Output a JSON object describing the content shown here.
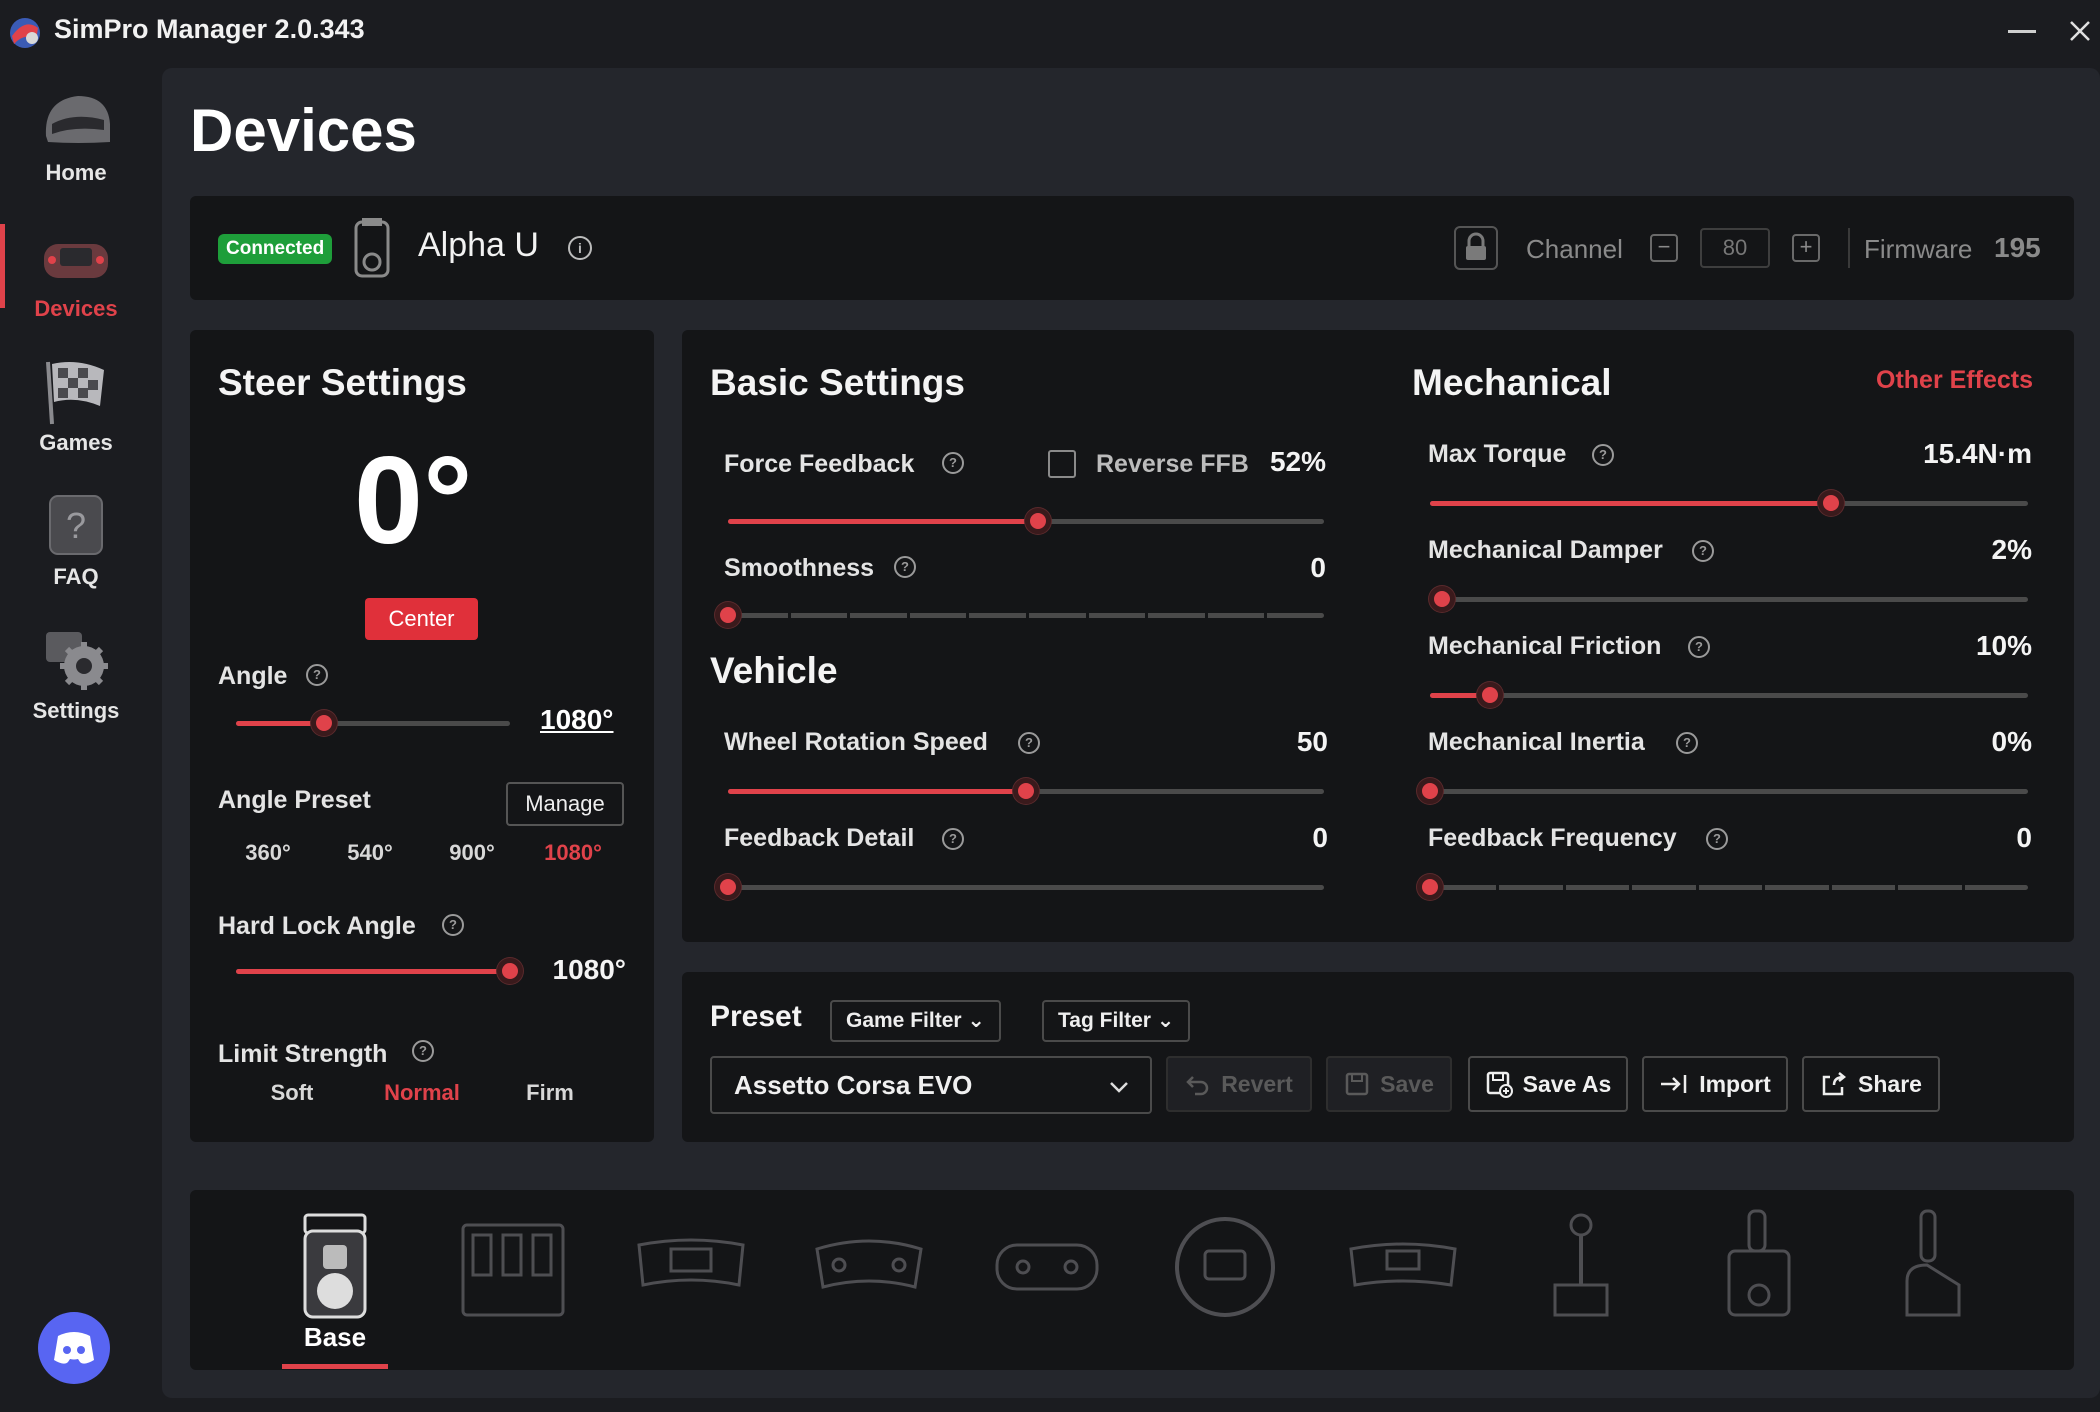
{
  "window": {
    "title": "SimPro Manager 2.0.343"
  },
  "sidebar": {
    "items": [
      {
        "label": "Home",
        "icon": "helmet-icon",
        "active": false
      },
      {
        "label": "Devices",
        "icon": "wheel-icon",
        "active": true
      },
      {
        "label": "Games",
        "icon": "checkered-flag-icon",
        "active": false
      },
      {
        "label": "FAQ",
        "icon": "question-icon",
        "active": false
      },
      {
        "label": "Settings",
        "icon": "gear-icon",
        "active": false
      }
    ],
    "discord_icon": "discord-icon"
  },
  "page": {
    "title": "Devices"
  },
  "device_bar": {
    "status": "Connected",
    "device_name": "Alpha U",
    "channel_label": "Channel",
    "channel_value": "80",
    "firmware_label": "Firmware",
    "firmware_value": "195"
  },
  "steer": {
    "title": "Steer Settings",
    "current_angle": "0°",
    "center_label": "Center",
    "angle_label": "Angle",
    "angle_value": "1080°",
    "angle_fraction": 0.32,
    "angle_preset_label": "Angle Preset",
    "manage_label": "Manage",
    "presets": [
      "360°",
      "540°",
      "900°",
      "1080°"
    ],
    "selected_preset": "1080°",
    "hard_lock_label": "Hard Lock Angle",
    "hard_lock_value": "1080°",
    "hard_lock_fraction": 1.0,
    "limit_strength_label": "Limit Strength",
    "limit_options": [
      "Soft",
      "Normal",
      "Firm"
    ],
    "selected_limit": "Normal"
  },
  "basic": {
    "title": "Basic Settings",
    "force_feedback_label": "Force Feedback",
    "reverse_ffb_label": "Reverse FFB",
    "reverse_ffb_checked": false,
    "force_feedback_value": "52%",
    "force_feedback_fraction": 0.52,
    "smoothness_label": "Smoothness",
    "smoothness_value": "0",
    "smoothness_fraction": 0.0
  },
  "vehicle": {
    "title": "Vehicle",
    "wheel_rotation_label": "Wheel Rotation Speed",
    "wheel_rotation_value": "50",
    "wheel_rotation_fraction": 0.5,
    "feedback_detail_label": "Feedback Detail",
    "feedback_detail_value": "0",
    "feedback_detail_fraction": 0.0
  },
  "mechanical": {
    "title": "Mechanical",
    "other_effects_label": "Other Effects",
    "max_torque_label": "Max Torque",
    "max_torque_value": "15.4N·m",
    "max_torque_fraction": 0.67,
    "damper_label": "Mechanical Damper",
    "damper_value": "2%",
    "damper_fraction": 0.02,
    "friction_label": "Mechanical Friction",
    "friction_value": "10%",
    "friction_fraction": 0.1,
    "inertia_label": "Mechanical Inertia",
    "inertia_value": "0%",
    "inertia_fraction": 0.0,
    "feedback_freq_label": "Feedback Frequency",
    "feedback_freq_value": "0",
    "feedback_freq_fraction": 0.0
  },
  "preset": {
    "title": "Preset",
    "game_filter_label": "Game Filter",
    "tag_filter_label": "Tag Filter",
    "selected": "Assetto Corsa EVO",
    "revert_label": "Revert",
    "save_label": "Save",
    "save_as_label": "Save As",
    "import_label": "Import",
    "share_label": "Share"
  },
  "device_strip": {
    "active_label": "Base",
    "items": [
      "base-icon",
      "pedals-icon",
      "formula-wheel-icon",
      "gt-wheel-icon",
      "wheel-rim-icon",
      "round-wheel-icon",
      "formula-rim-icon",
      "shifter-icon",
      "sequential-shifter-icon",
      "handbrake-icon"
    ]
  },
  "colors": {
    "accent": "#e0424a",
    "connected": "#1e9e3a",
    "background": "#1b1c20",
    "panel": "#141517"
  }
}
